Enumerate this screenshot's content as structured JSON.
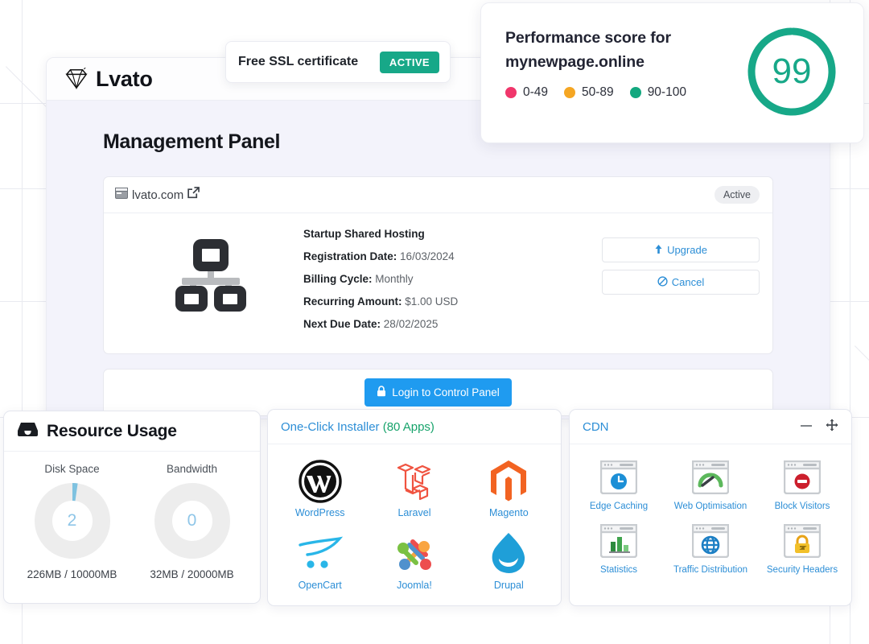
{
  "brand": {
    "name": "Lvato",
    "logo_icon": "diamond-icon"
  },
  "ssl": {
    "label": "Free SSL certificate",
    "status": "ACTIVE",
    "status_color": "#17a888"
  },
  "performance": {
    "title_line1": "Performance score for",
    "title_line2": "mynewpage.online",
    "score": "99",
    "score_color": "#17a888",
    "legend": [
      {
        "label": "0-49",
        "color": "#f0366b"
      },
      {
        "label": "50-89",
        "color": "#f5a623"
      },
      {
        "label": "90-100",
        "color": "#13a87f"
      }
    ]
  },
  "panel": {
    "title": "Management Panel"
  },
  "hosting": {
    "domain": "lvato.com",
    "domain_icon": "window-icon",
    "external_link_icon": "external-link-icon",
    "status_badge": "Active",
    "plan_icon": "sitemap-icon",
    "plan": "Startup Shared Hosting",
    "fields": [
      {
        "label": "Registration Date:",
        "value": "16/03/2024"
      },
      {
        "label": "Billing Cycle:",
        "value": "Monthly"
      },
      {
        "label": "Recurring Amount:",
        "value": "$1.00 USD"
      },
      {
        "label": "Next Due Date:",
        "value": "28/02/2025"
      }
    ],
    "actions": [
      {
        "label": "Upgrade",
        "icon": "arrow-up-icon"
      },
      {
        "label": "Cancel",
        "icon": "ban-icon"
      }
    ],
    "login_button": {
      "label": "Login to Control Panel",
      "icon": "lock-icon",
      "color": "#1f9bf0"
    }
  },
  "resource_usage": {
    "title": "Resource Usage",
    "title_icon": "inbox-icon",
    "metrics": [
      {
        "label": "Disk Space",
        "value": "2",
        "percent": 2.26,
        "detail": "226MB / 10000MB"
      },
      {
        "label": "Bandwidth",
        "value": "0",
        "percent": 0.16,
        "detail": "32MB / 20000MB"
      }
    ],
    "arc_color": "#7fc2e0",
    "track_color": "#ededed"
  },
  "installer": {
    "title": "One-Click Installer",
    "count": "(80 Apps)",
    "apps": [
      {
        "label": "WordPress",
        "icon": "wordpress-icon"
      },
      {
        "label": "Laravel",
        "icon": "laravel-icon"
      },
      {
        "label": "Magento",
        "icon": "magento-icon"
      },
      {
        "label": "OpenCart",
        "icon": "opencart-icon"
      },
      {
        "label": "Joomla!",
        "icon": "joomla-icon"
      },
      {
        "label": "Drupal",
        "icon": "drupal-icon"
      }
    ]
  },
  "cdn": {
    "title": "CDN",
    "minimize_icon": "minimize-icon",
    "move_icon": "move-icon",
    "items": [
      {
        "label": "Edge Caching",
        "icon": "clock-icon"
      },
      {
        "label": "Web Optimisation",
        "icon": "gauge-icon"
      },
      {
        "label": "Block Visitors",
        "icon": "block-icon"
      },
      {
        "label": "Statistics",
        "icon": "bar-chart-icon"
      },
      {
        "label": "Traffic Distribution",
        "icon": "globe-icon"
      },
      {
        "label": "Security Headers",
        "icon": "lock-shield-icon"
      }
    ]
  }
}
